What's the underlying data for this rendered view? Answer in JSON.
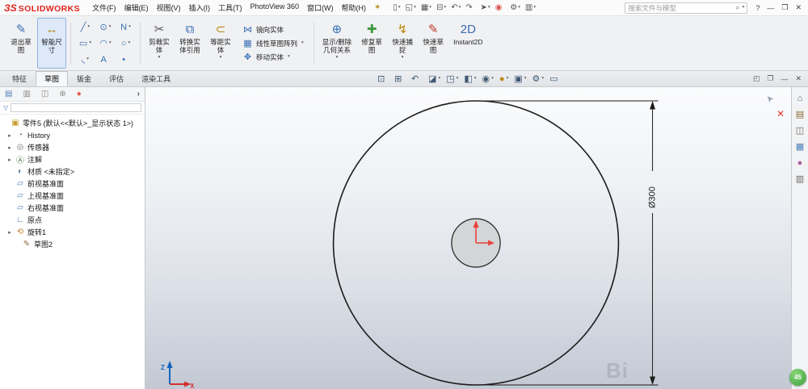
{
  "ui": {
    "dd": "▾",
    "expand": "▸",
    "pin": "✶",
    "search_glyph": "⌕",
    "funnel": "▽",
    "chevron": "›",
    "cursor": "➤",
    "close_x": "✕"
  },
  "colors": {
    "brand_red": "#e2231a",
    "selection_fill": "#dde9f9",
    "selection_border": "#8fb3e3",
    "dimension": "#1c1c1c",
    "origin_arrows": "#e8413c",
    "triad_x": "#d32f2f",
    "triad_z": "#1565c0",
    "badge_green": "#4caf50"
  },
  "window": {
    "logo_prefix": "ЗS",
    "logo_text": "SOLIDWORKS",
    "search_placeholder": "搜索文件与模型"
  },
  "menus": [
    {
      "label": "文件(F)"
    },
    {
      "label": "编辑(E)"
    },
    {
      "label": "视图(V)"
    },
    {
      "label": "插入(I)"
    },
    {
      "label": "工具(T)"
    },
    {
      "label": "PhotoView 360"
    },
    {
      "label": "窗口(W)"
    },
    {
      "label": "帮助(H)"
    }
  ],
  "quickbar": [
    {
      "name": "new-document-icon",
      "glyph": "▯",
      "color": "#555",
      "dd": true
    },
    {
      "name": "open-document-icon",
      "glyph": "◱",
      "color": "#555",
      "dd": true
    },
    {
      "name": "save-icon",
      "glyph": "▦",
      "color": "#555",
      "dd": true
    },
    {
      "name": "print-icon",
      "glyph": "⊟",
      "color": "#555",
      "dd": true
    },
    {
      "name": "undo-icon",
      "glyph": "↶",
      "color": "#555",
      "dd": true
    },
    {
      "name": "redo-icon",
      "glyph": "↷",
      "color": "#555",
      "dd": false
    },
    {
      "name": "select-icon",
      "glyph": "➤",
      "color": "#555",
      "dd": true
    },
    {
      "name": "record-indicator-icon",
      "glyph": "◉",
      "color": "#d9534f",
      "dd": false
    },
    {
      "name": "options-gear-icon",
      "glyph": "⚙",
      "color": "#555",
      "dd": true
    },
    {
      "name": "display-settings-icon",
      "glyph": "▥",
      "color": "#555",
      "dd": true
    }
  ],
  "window_controls": [
    {
      "name": "help-icon",
      "glyph": "?"
    },
    {
      "name": "minimize-icon",
      "glyph": "—"
    },
    {
      "name": "maximize-icon",
      "glyph": "❐"
    },
    {
      "name": "close-icon",
      "glyph": "✕"
    }
  ],
  "toolbar": {
    "group1": [
      {
        "name": "exit-sketch-button",
        "icon": "exit-sketch-icon",
        "glyph": "✎",
        "color": "#3a6fb5",
        "label": "退出草\n图",
        "dd": false,
        "selected": false
      },
      {
        "name": "smart-dimension-button",
        "icon": "smart-dimension-icon",
        "glyph": "↔",
        "color": "#b8860b",
        "label": "智能尺\n寸",
        "dd": false,
        "selected": true
      }
    ],
    "sketch_tools": [
      {
        "name": "line-tool-icon",
        "glyph": "╱",
        "color": "#3a6fb5",
        "dd": true
      },
      {
        "name": "circle-tool-icon",
        "glyph": "⊙",
        "color": "#3a6fb5",
        "dd": true
      },
      {
        "name": "spline-tool-icon",
        "glyph": "N",
        "color": "#3a6fb5",
        "dd": true
      },
      {
        "name": "rectangle-tool-icon",
        "glyph": "▭",
        "color": "#3a6fb5",
        "dd": true
      },
      {
        "name": "arc-tool-icon",
        "glyph": "◠",
        "color": "#3a6fb5",
        "dd": true
      },
      {
        "name": "ellipse-tool-icon",
        "glyph": "○",
        "color": "#3a6fb5",
        "dd": true
      },
      {
        "name": "fillet-tool-icon",
        "glyph": "◟",
        "color": "#3a6fb5",
        "dd": true
      },
      {
        "name": "text-tool-icon",
        "glyph": "A",
        "color": "#3a6fb5",
        "dd": false
      },
      {
        "name": "point-tool-icon",
        "glyph": "•",
        "color": "#3a6fb5",
        "dd": false
      }
    ],
    "group2": [
      {
        "name": "trim-entities-button",
        "icon": "trim-scissors-icon",
        "glyph": "✂",
        "color": "#555",
        "label": "剪裁实\n体",
        "dd": true,
        "selected": false
      },
      {
        "name": "convert-entities-button",
        "icon": "convert-entities-icon",
        "glyph": "⧉",
        "color": "#3a6fb5",
        "label": "转换实\n体引用",
        "dd": false,
        "selected": false
      },
      {
        "name": "offset-entities-button",
        "icon": "offset-entities-icon",
        "glyph": "⊂",
        "color": "#b8860b",
        "label": "等距实\n体",
        "dd": true,
        "selected": false
      }
    ],
    "stack": [
      {
        "name": "mirror-entities-button",
        "icon": "mirror-entities-icon",
        "glyph": "⋈",
        "color": "#3a6fb5",
        "label": "镜向实体",
        "dd": false
      },
      {
        "name": "linear-sketch-pattern-button",
        "icon": "linear-pattern-icon",
        "glyph": "▦",
        "color": "#3a6fb5",
        "label": "线性草图阵列",
        "dd": true
      },
      {
        "name": "move-entities-button",
        "icon": "move-entities-icon",
        "glyph": "✥",
        "color": "#3a6fb5",
        "label": "移动实体",
        "dd": true
      }
    ],
    "group3": [
      {
        "name": "display-delete-relations-button",
        "icon": "relations-icon",
        "glyph": "⊕",
        "color": "#3a6fb5",
        "label": "显示/删除\n几何关系",
        "dd": true,
        "selected": false
      },
      {
        "name": "repair-sketch-button",
        "icon": "repair-sketch-icon",
        "glyph": "✚",
        "color": "#3a9a3a",
        "label": "修复草\n图",
        "dd": false,
        "selected": false
      },
      {
        "name": "quick-snaps-button",
        "icon": "quick-snaps-icon",
        "glyph": "↯",
        "color": "#b8860b",
        "label": "快速捕\n捉",
        "dd": true,
        "selected": false
      },
      {
        "name": "rapid-sketch-button",
        "icon": "rapid-sketch-icon",
        "glyph": "✎",
        "color": "#c0392b",
        "label": "快速草\n图",
        "dd": false,
        "selected": false
      },
      {
        "name": "instant2d-button",
        "icon": "instant2d-icon",
        "glyph": "2D",
        "color": "#3a6fb5",
        "label": "Instant2D",
        "dd": false,
        "selected": false
      }
    ]
  },
  "tabs": [
    {
      "label": "特征",
      "active": false
    },
    {
      "label": "草图",
      "active": true
    },
    {
      "label": "钣金",
      "active": false
    },
    {
      "label": "评估",
      "active": false
    },
    {
      "label": "渲染工具",
      "active": false
    }
  ],
  "headsup": [
    {
      "name": "zoom-fit-icon",
      "glyph": "⊡",
      "color": "#3f5873",
      "dd": false
    },
    {
      "name": "zoom-area-icon",
      "glyph": "⊞",
      "color": "#3f5873",
      "dd": false
    },
    {
      "name": "previous-view-icon",
      "glyph": "↶",
      "color": "#3f5873",
      "dd": false
    },
    {
      "name": "section-view-icon",
      "glyph": "◪",
      "color": "#3f5873",
      "dd": true
    },
    {
      "name": "view-orientation-icon",
      "glyph": "◳",
      "color": "#3f5873",
      "dd": true
    },
    {
      "name": "display-style-icon",
      "glyph": "◧",
      "color": "#3f5873",
      "dd": true
    },
    {
      "name": "hide-show-items-icon",
      "glyph": "◉",
      "color": "#3f5873",
      "dd": true
    },
    {
      "name": "edit-appearance-icon",
      "glyph": "●",
      "color": "#b8860b",
      "dd": true
    },
    {
      "name": "apply-scene-icon",
      "glyph": "▣",
      "color": "#3f5873",
      "dd": true
    },
    {
      "name": "view-settings-icon",
      "glyph": "⚙",
      "color": "#3f5873",
      "dd": true
    },
    {
      "name": "monitor-icon",
      "glyph": "▭",
      "color": "#3f5873",
      "dd": false
    }
  ],
  "pane_controls": [
    {
      "name": "pane-split-icon",
      "glyph": "◰"
    },
    {
      "name": "pane-window-icon",
      "glyph": "❐"
    },
    {
      "name": "pane-minimize-icon",
      "glyph": "—"
    },
    {
      "name": "pane-close-icon",
      "glyph": "✕"
    }
  ],
  "panel_tabs": [
    {
      "name": "featuremanager-tab-icon",
      "glyph": "▤",
      "color": "#4a7ebb"
    },
    {
      "name": "propertymanager-tab-icon",
      "glyph": "▥",
      "color": "#888"
    },
    {
      "name": "configurationmanager-tab-icon",
      "glyph": "◫",
      "color": "#888"
    },
    {
      "name": "dimxpert-tab-icon",
      "glyph": "⊕",
      "color": "#888"
    },
    {
      "name": "displaymanager-tab-icon",
      "glyph": "●",
      "color": "#e2574c"
    }
  ],
  "tree_items": [
    {
      "arrow": false,
      "name": "part-icon",
      "glyph": "▣",
      "color": "#c59a2f",
      "label": "零件5 (默认<<默认>_显示状态 1>)",
      "pad": "2px"
    },
    {
      "arrow": true,
      "name": "history-icon",
      "glyph": "◔",
      "color": "#777",
      "label": "History",
      "pad": "8px"
    },
    {
      "arrow": true,
      "name": "sensors-icon",
      "glyph": "◎",
      "color": "#777",
      "label": "传感器",
      "pad": "8px"
    },
    {
      "arrow": true,
      "name": "annotations-icon",
      "glyph": "Ⓐ",
      "color": "#557a3c",
      "label": "注解",
      "pad": "8px"
    },
    {
      "arrow": false,
      "name": "material-icon",
      "glyph": "◐",
      "color": "#5b7fa6",
      "label": "材质 <未指定>",
      "pad": "8px"
    },
    {
      "arrow": false,
      "name": "plane-icon",
      "glyph": "▱",
      "color": "#4a7ebb",
      "label": "前视基准面",
      "pad": "8px"
    },
    {
      "arrow": false,
      "name": "plane-icon",
      "glyph": "▱",
      "color": "#4a7ebb",
      "label": "上视基准面",
      "pad": "8px"
    },
    {
      "arrow": false,
      "name": "plane-icon",
      "glyph": "▱",
      "color": "#4a7ebb",
      "label": "右视基准面",
      "pad": "8px"
    },
    {
      "arrow": false,
      "name": "origin-icon",
      "glyph": "∟",
      "color": "#4a7ebb",
      "label": "原点",
      "pad": "8px"
    },
    {
      "arrow": true,
      "name": "revolve-icon",
      "glyph": "⟲",
      "color": "#c77b2f",
      "label": "旋转1",
      "pad": "8px"
    },
    {
      "arrow": false,
      "name": "sketch-icon",
      "glyph": "✎",
      "color": "#8a6d3b",
      "label": "草图2",
      "pad": "16px"
    }
  ],
  "taskpane": [
    {
      "name": "resources-home-icon",
      "glyph": "⌂",
      "color": "#666"
    },
    {
      "name": "design-library-icon",
      "glyph": "▤",
      "color": "#8a6d3b"
    },
    {
      "name": "file-explorer-icon",
      "glyph": "◫",
      "color": "#666"
    },
    {
      "name": "view-palette-icon",
      "glyph": "▦",
      "color": "#4a7ebb"
    },
    {
      "name": "appearances-icon",
      "glyph": "●",
      "color": "#b05fa0"
    },
    {
      "name": "custom-properties-icon",
      "glyph": "▥",
      "color": "#666"
    }
  ],
  "viewport": {
    "dimension_label": "Ø300",
    "triad_z": "Z",
    "triad_x": "X",
    "watermark": "Bi",
    "badge": "45"
  }
}
